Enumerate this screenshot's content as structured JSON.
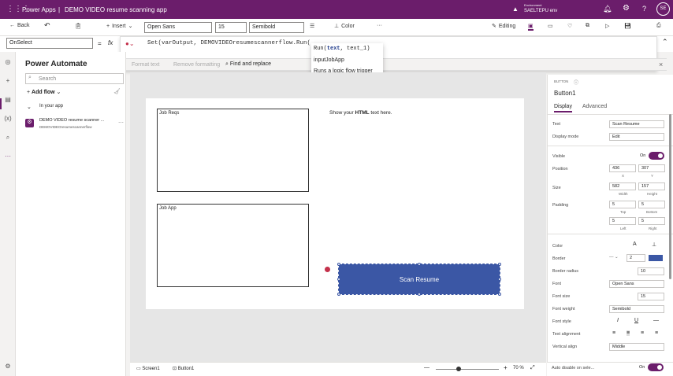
{
  "titlebar": {
    "app": "Power Apps",
    "separator": "|",
    "project": "DEMO VIDEO resume scanning app",
    "env_label": "Environment",
    "env_name": "SAELTEPU env",
    "avatar": "SE"
  },
  "toolbar": {
    "back": "Back",
    "insert": "Insert",
    "font": "Open Sans",
    "font_size": "15",
    "font_weight": "Semibold",
    "color": "Color",
    "editing": "Editing"
  },
  "formula": {
    "property": "OnSelect",
    "equals": "=",
    "fx": "fx",
    "text": "Set(varOutput, DEMOVIDEOresumescannerflow.Run(",
    "format_text": "Format text",
    "remove_formatting": "Remove formatting",
    "find_replace": "Find and replace"
  },
  "autocomplete": {
    "items": [
      {
        "label": "Run(",
        "param1": "text",
        "rest": ", text_1)"
      },
      {
        "label": "inputJobApp"
      },
      {
        "label": "Runs a logic flow trigger"
      }
    ]
  },
  "left_panel": {
    "title": "Power Automate",
    "search_placeholder": "Search",
    "add_flow": "Add flow",
    "section": "In your app",
    "flow_name": "DEMO VIDEO resume scanner ...",
    "flow_id": "DEMOVIDEOresumescannerflow"
  },
  "canvas": {
    "label1": "Job Reqs",
    "label2": "Job App",
    "html_text_pre": "Show your ",
    "html_text_bold": "HTML",
    "html_text_post": " text here.",
    "button": "Scan Resume"
  },
  "properties": {
    "type": "BUTTON",
    "name": "Button1",
    "tab_display": "Display",
    "tab_advanced": "Advanced",
    "text_label": "Text",
    "text_value": "Scan Resume",
    "display_mode_label": "Display mode",
    "display_mode": "Edit",
    "visible_label": "Visible",
    "visible_state": "On",
    "position_label": "Position",
    "x": "436",
    "y": "307",
    "x_label": "X",
    "y_label": "Y",
    "size_label": "Size",
    "width": "582",
    "height": "157",
    "width_label": "Width",
    "height_label": "Height",
    "padding_label": "Padding",
    "pad_top": "5",
    "pad_bottom": "5",
    "pad_left": "5",
    "pad_right": "5",
    "top_label": "Top",
    "bottom_label": "Bottom",
    "left_label": "Left",
    "right_label": "Right",
    "color_label": "Color",
    "border_label": "Border",
    "border_width": "2",
    "border_radius_label": "Border radius",
    "border_radius": "10",
    "font_label": "Font",
    "font": "Open Sans",
    "font_size_label": "Font size",
    "font_size": "15",
    "font_weight_label": "Font weight",
    "font_weight": "Semibold",
    "font_style_label": "Font style",
    "text_align_label": "Text alignment",
    "valign_label": "Vertical align",
    "valign": "Middle",
    "auto_disable_label": "Auto disable on sele...",
    "auto_disable_state": "On"
  },
  "status": {
    "screen": "Screen1",
    "control": "Button1",
    "zoom": "70 %",
    "zoom_minus": "—",
    "zoom_plus": "+"
  },
  "colors": {
    "brand": "#6b1d6b",
    "button": "#3b57a5"
  }
}
